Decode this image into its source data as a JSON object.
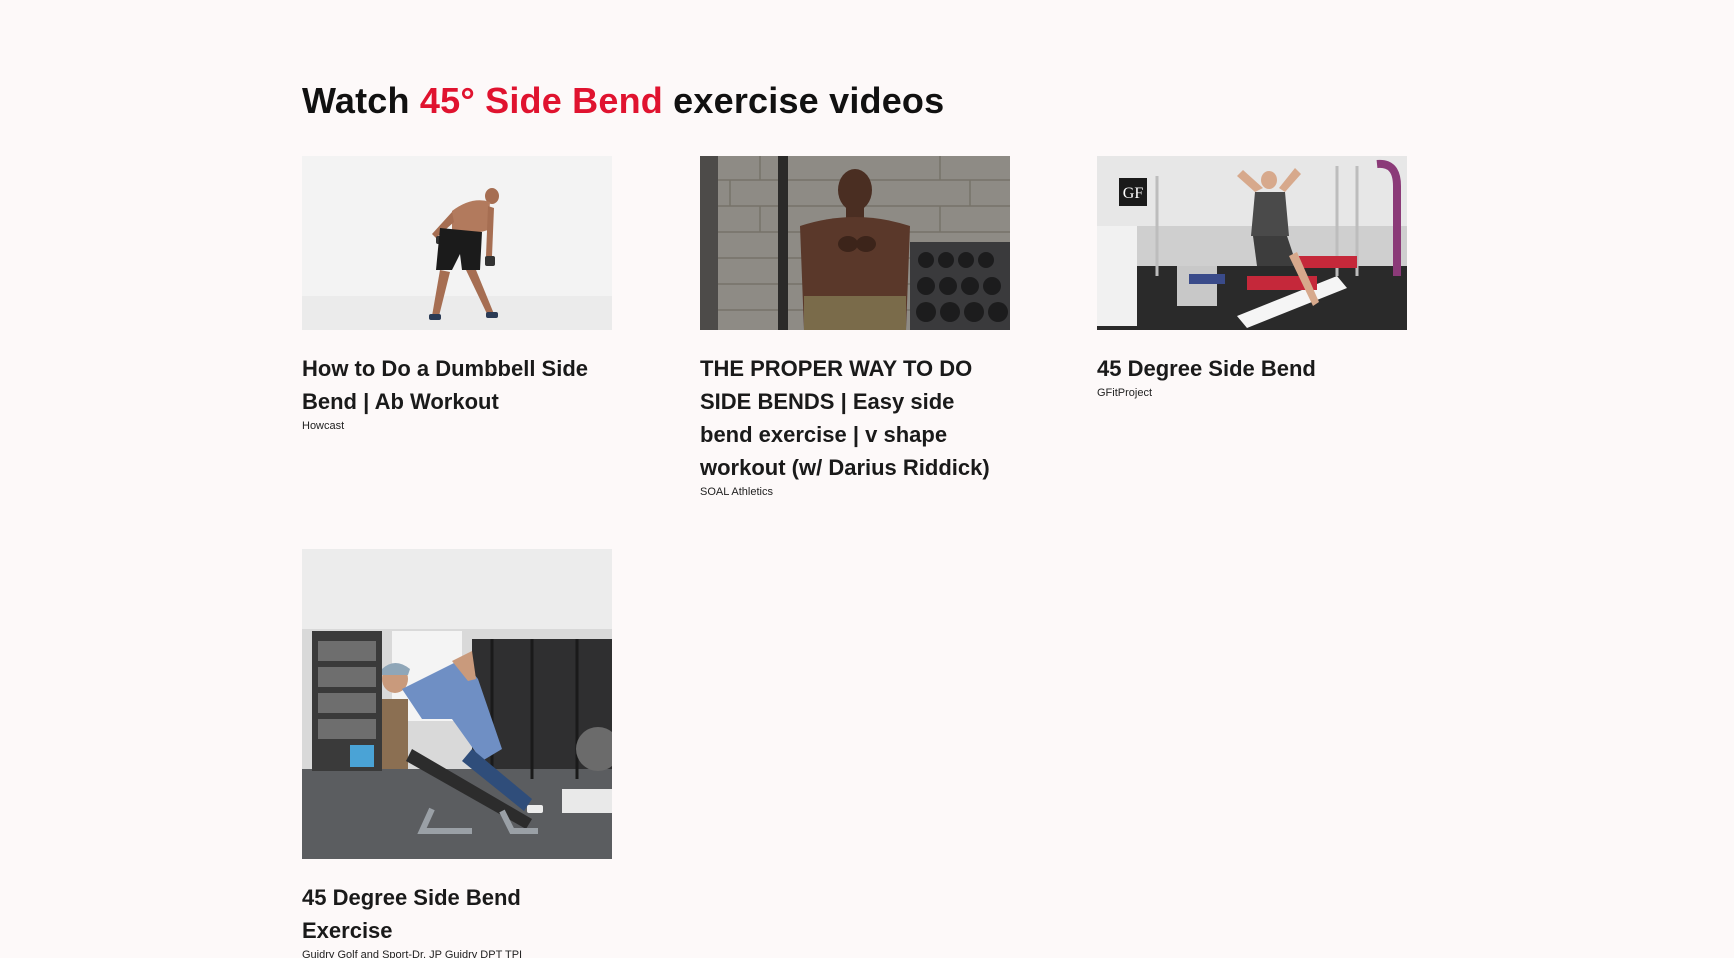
{
  "section": {
    "title_prefix": "Watch ",
    "title_accent": "45° Side Bend",
    "title_suffix": " exercise videos",
    "accent_color": "#e0132f"
  },
  "videos": [
    {
      "title": "How to Do a Dumbbell Side Bend | Ab Workout",
      "channel": "Howcast"
    },
    {
      "title": "THE PROPER WAY TO DO SIDE BENDS | Easy side bend exercise | v shape workout (w/ Darius Riddick)",
      "channel": "SOAL Athletics"
    },
    {
      "title": "45 Degree Side Bend",
      "channel": "GFitProject",
      "logo_text": "GF"
    },
    {
      "title": "45 Degree Side Bend Exercise",
      "channel": "Guidry Golf and Sport-Dr. JP Guidry DPT TPI"
    }
  ]
}
